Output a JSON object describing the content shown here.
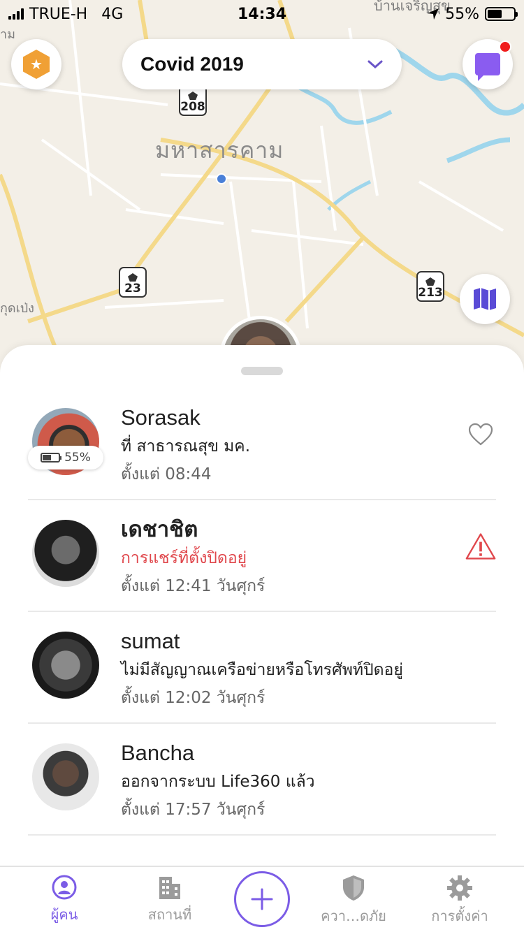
{
  "status_bar": {
    "carrier": "TRUE-H",
    "network": "4G",
    "time": "14:34",
    "battery_percent_label": "55%",
    "battery_level": 0.55
  },
  "map": {
    "city_label": "มหาสารคาม",
    "top_label": "บ้านเจริญสุข",
    "left_label": "าม",
    "left_label_2": "กุดเป่ง",
    "route_shields": [
      "208",
      "23",
      "213"
    ]
  },
  "header": {
    "circle_name": "Covid 2019",
    "premium_icon": "star-hexagon-icon",
    "messages_icon": "chat-bubble-icon",
    "messages_unread": true
  },
  "members": [
    {
      "name": "Sorasak",
      "status": "ที่ สาธารณสุข มค.",
      "since": "ตั้งแต่ 08:44",
      "battery_label": "55%",
      "battery_level": 0.55,
      "trailing_icon": "heart-outline-icon",
      "status_alert": false
    },
    {
      "name": "เดชาชิต",
      "status": "การแชร์ที่ตั้งปิดอยู่",
      "since": "ตั้งแต่ 12:41 วันศุกร์",
      "trailing_icon": "warning-triangle-icon",
      "status_alert": true
    },
    {
      "name": "sumat",
      "status": "ไม่มีสัญญาณเครือข่ายหรือโทรศัพท์ปิดอยู่",
      "since": "ตั้งแต่ 12:02 วันศุกร์",
      "status_alert": false
    },
    {
      "name": "Bancha",
      "status": "ออกจากระบบ Life360 แล้ว",
      "since": "ตั้งแต่ 17:57 วันศุกร์",
      "status_alert": false
    }
  ],
  "tabs": [
    {
      "label": "ผู้คน",
      "icon": "person-pin-icon",
      "active": true
    },
    {
      "label": "สถานที่",
      "icon": "building-icon",
      "active": false
    },
    {
      "label": "ควา…ดภัย",
      "icon": "shield-icon",
      "active": false
    },
    {
      "label": "การตั้งค่า",
      "icon": "gear-icon",
      "active": false
    }
  ],
  "colors": {
    "accent": "#7b5ce6",
    "alert": "#e0474c",
    "premium": "#f0a035",
    "chat": "#8a5cf0",
    "notification": "#f01d1d"
  }
}
